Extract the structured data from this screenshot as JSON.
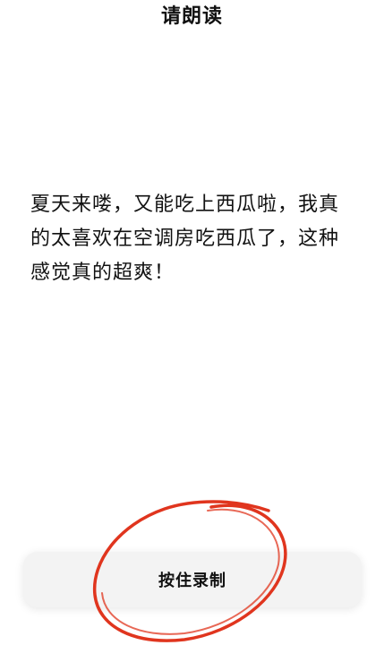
{
  "header": {
    "title": "请朗读"
  },
  "reading": {
    "text": "夏天来喽，又能吃上西瓜啦，我真的太喜欢在空调房吃西瓜了，这种感觉真的超爽！"
  },
  "record": {
    "label": "按住录制"
  },
  "colors": {
    "annotation_circle": "#e0351e",
    "button_bg": "#f3f3f3"
  }
}
